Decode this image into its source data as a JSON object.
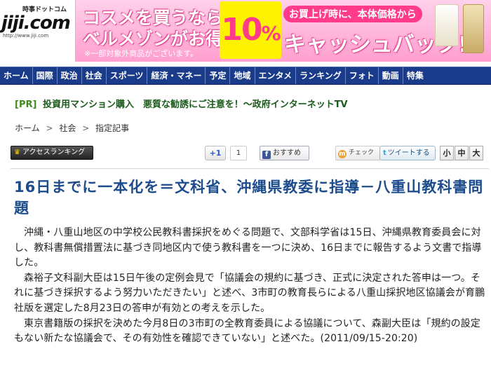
{
  "header": {
    "logo": {
      "top": "時事ドットコム",
      "main": "jiji.com",
      "url": "http://www.jiji.com"
    },
    "ad": {
      "line1": "コスメを買うなら",
      "line2": "ベルメゾンがお得!!",
      "note": "※一部対象外商品がございます。",
      "percent_number": "10",
      "percent_sign": "%",
      "badge": "お買上げ時に、本体価格から",
      "big": "キャッシュバック!!",
      "colors": {
        "bg": "#ffb3d9",
        "yellow": "#fff200",
        "accent": "#ff3b8a"
      }
    }
  },
  "nav": {
    "items": [
      "ホーム",
      "国際",
      "政治",
      "社会",
      "スポーツ",
      "経済・マネー",
      "予定",
      "地域",
      "エンタメ",
      "ランキング",
      "フォト",
      "動画",
      "特集"
    ],
    "color": "#1a3a8a"
  },
  "pr": {
    "tag": "[PR]",
    "text": "投資用マンション購入　悪質な勧誘にご注意を！～政府インターネットTV"
  },
  "breadcrumb": {
    "items": [
      "ホーム",
      "社会",
      "指定記事"
    ],
    "separator": ">"
  },
  "toolbar": {
    "ranking_label": "アクセスランキング",
    "ranking_icon": "crown-icon",
    "plus_label": "+1",
    "plus_count": "1",
    "facebook_label": "おすすめ",
    "facebook_icon": "f",
    "mixi_label": "チェック",
    "mixi_icon": "m",
    "twitter_label": "ツイートする",
    "twitter_icon": "t",
    "size_labels": [
      "小",
      "中",
      "大"
    ]
  },
  "article": {
    "headline": "16日までに一本化を＝文科省、沖縄県教委に指導－八重山教科書問題",
    "paragraphs": [
      "沖縄・八重山地区の中学校公民教科書採択をめぐる問題で、文部科学省は15日、沖縄県教育委員会に対し、教科書無償措置法に基づき同地区内で使う教科書を一つに決め、16日までに報告するよう文書で指導した。",
      "森裕子文科副大臣は15日午後の定例会見で「協議会の規約に基づき、正式に決定された答申は一つ。それに基づき採択するよう努力いただきたい」と述べ、3市町の教育長らによる八重山採択地区協議会が育鵬社版を選定した8月23日の答申が有効との考えを示した。",
      "東京書籍版の採択を決めた今月8日の3市町の全教育委員による協議について、森副大臣は「規約の設定もない新たな協議会で、その有効性を確認できていない」と述べた。(2011/09/15-20:20)"
    ]
  }
}
